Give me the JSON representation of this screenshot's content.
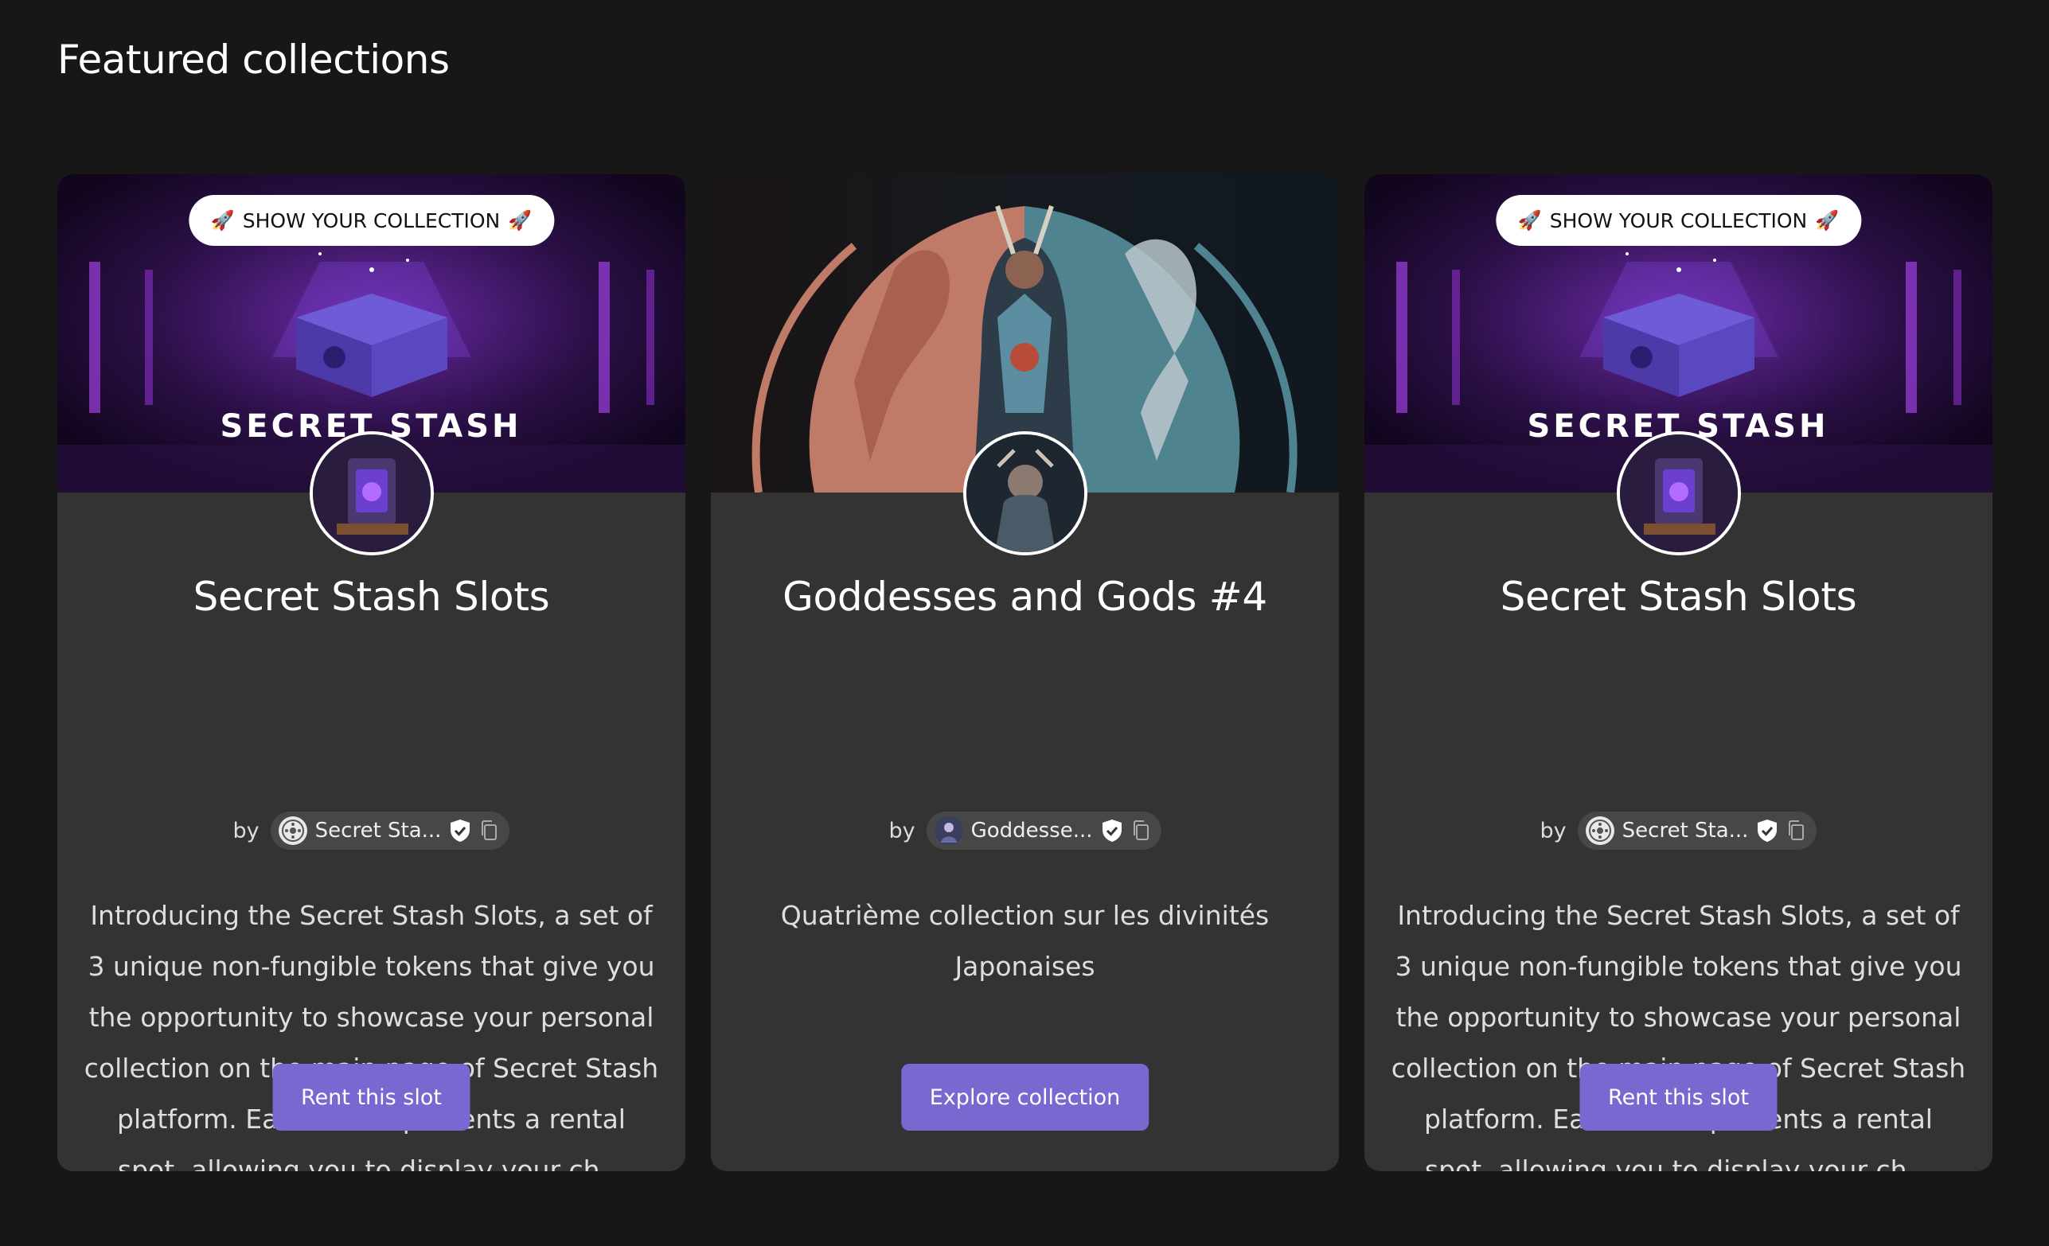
{
  "section": {
    "title": "Featured collections"
  },
  "cards": [
    {
      "badge": "SHOW YOUR COLLECTION",
      "banner_text": "SECRET STASH",
      "title": "Secret Stash Slots",
      "by": "by",
      "creator": "Secret Sta...",
      "description": "Introducing the Secret Stash Slots, a set of 3 unique non-fungible tokens that give you the opportunity to showcase your personal collection on the main page of Secret Stash platform. Each NFT represents a rental spot, allowing you to display your ch...",
      "cta": "Rent this slot"
    },
    {
      "title": "Goddesses and Gods #4",
      "by": "by",
      "creator": "Goddesse...",
      "description": "Quatrième collection sur les divinités Japonaises",
      "cta": "Explore collection"
    },
    {
      "badge": "SHOW YOUR COLLECTION",
      "banner_text": "SECRET STASH",
      "title": "Secret Stash Slots",
      "by": "by",
      "creator": "Secret Sta...",
      "description": "Introducing the Secret Stash Slots, a set of 3 unique non-fungible tokens that give you the opportunity to showcase your personal collection on the main page of Secret Stash platform. Each NFT represents a rental spot, allowing you to display your ch...",
      "cta": "Rent this slot"
    }
  ],
  "colors": {
    "background": "#171717",
    "card": "#333333",
    "accent": "#7a67d0"
  },
  "icons": [
    "rocket-icon",
    "verified-shield-icon",
    "copy-icon"
  ]
}
